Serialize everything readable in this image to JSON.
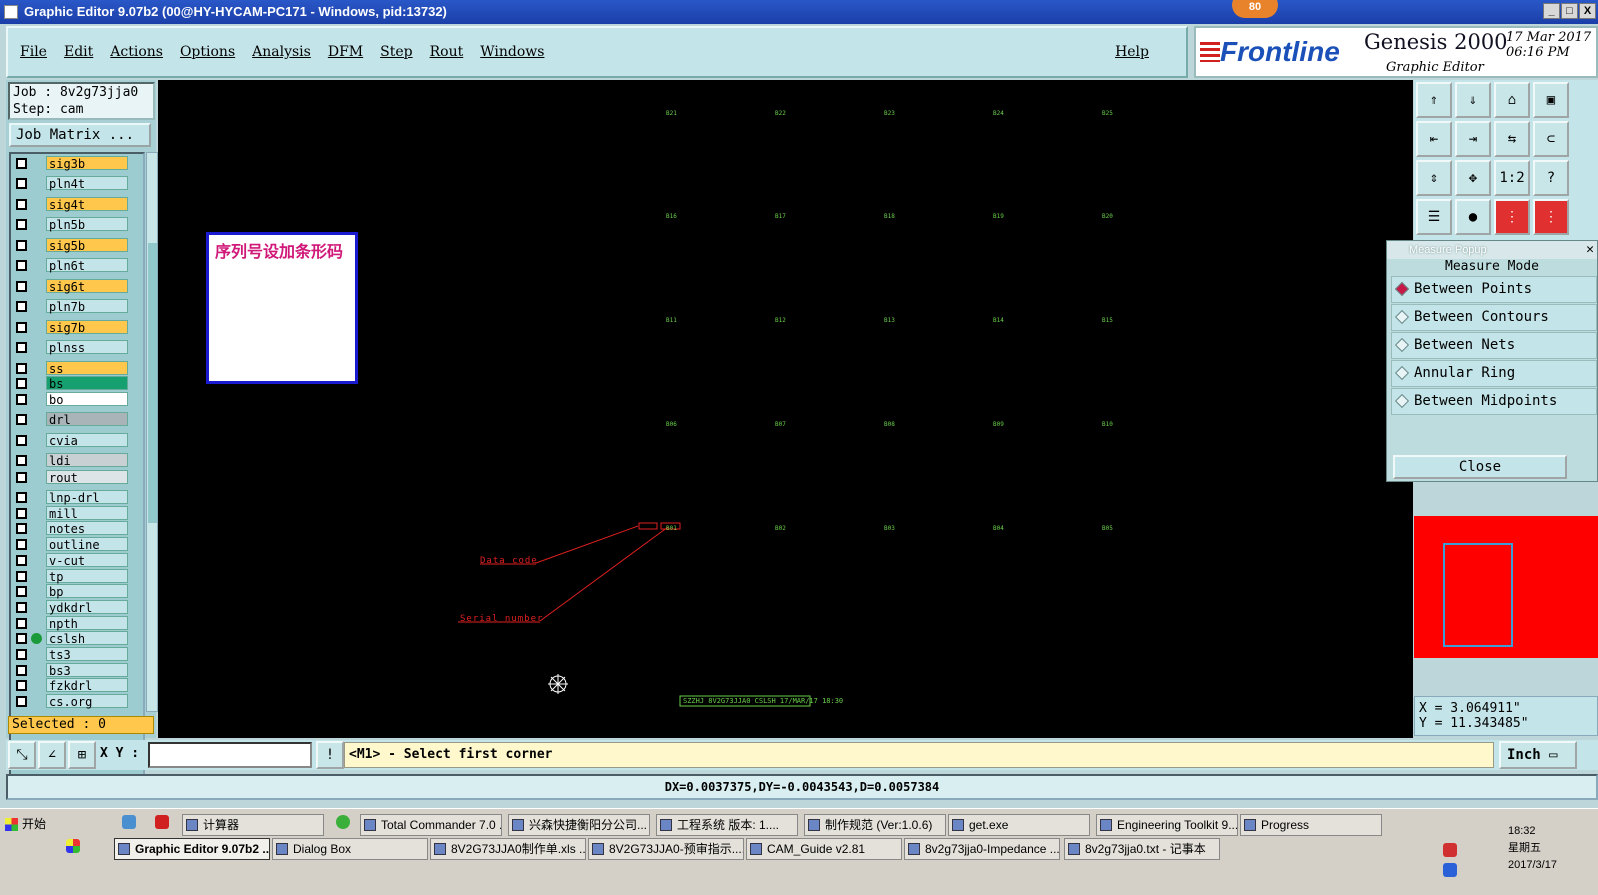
{
  "window": {
    "title": "Graphic Editor 9.07b2 (00@HY-HYCAM-PC171 - Windows, pid:13732)",
    "badge": "80",
    "controls": [
      "_",
      "□",
      "X"
    ]
  },
  "menu": {
    "items": [
      "File",
      "Edit",
      "Actions",
      "Options",
      "Analysis",
      "DFM",
      "Step",
      "Rout",
      "Windows"
    ],
    "help": "Help"
  },
  "brand": {
    "logo": "Frontline",
    "product": "Genesis 2000",
    "subtitle": "Graphic Editor",
    "date": "17 Mar 2017",
    "time": "06:16 PM"
  },
  "left": {
    "job": "Job : 8v2g73jja0",
    "step": "Step: cam",
    "job_matrix": "Job Matrix ...",
    "selected": "Selected : 0",
    "layers": [
      {
        "name": "sig3b",
        "color": "#ffc84c"
      },
      {
        "name": "pln4t",
        "color": "#c3e4e8"
      },
      {
        "name": "sig4t",
        "color": "#ffc84c"
      },
      {
        "name": "pln5b",
        "color": "#c3e4e8"
      },
      {
        "name": "sig5b",
        "color": "#ffc84c"
      },
      {
        "name": "pln6t",
        "color": "#c3e4e8"
      },
      {
        "name": "sig6t",
        "color": "#ffc84c"
      },
      {
        "name": "pln7b",
        "color": "#c3e4e8"
      },
      {
        "name": "sig7b",
        "color": "#ffc84c"
      },
      {
        "name": "plnss",
        "color": "#c3e4e8"
      },
      {
        "name": "ss",
        "color": "#ffc84c"
      },
      {
        "name": "bs",
        "color": "#16a070"
      },
      {
        "name": "bo",
        "color": "#ffffff"
      },
      {
        "name": "drl",
        "color": "#a8b4b8"
      },
      {
        "name": "cvia",
        "color": "#c3e4e8"
      },
      {
        "name": "ldi",
        "color": "#c8d0d4"
      },
      {
        "name": "rout",
        "color": "#dce4e8"
      },
      {
        "name": "lnp-drl",
        "color": "#c3e4e8"
      },
      {
        "name": "mill",
        "color": "#c3e4e8"
      },
      {
        "name": "notes",
        "color": "#c3e4e8"
      },
      {
        "name": "outline",
        "color": "#c3e4e8"
      },
      {
        "name": "v-cut",
        "color": "#c3e4e8"
      },
      {
        "name": "tp",
        "color": "#c3e4e8"
      },
      {
        "name": "bp",
        "color": "#c3e4e8"
      },
      {
        "name": "ydkdrl",
        "color": "#c3e4e8"
      },
      {
        "name": "npth",
        "color": "#c3e4e8"
      },
      {
        "name": "cslsh",
        "color": "#c3e4e8",
        "active": true
      },
      {
        "name": "ts3",
        "color": "#c3e4e8"
      },
      {
        "name": "bs3",
        "color": "#c3e4e8"
      },
      {
        "name": "fzkdrl",
        "color": "#c3e4e8"
      },
      {
        "name": "cs.org",
        "color": "#c3e4e8"
      }
    ]
  },
  "canvas": {
    "pads": [
      [
        "B21",
        "B22",
        "B23",
        "B24",
        "B25"
      ],
      [
        "B16",
        "B17",
        "B18",
        "B19",
        "B20"
      ],
      [
        "B11",
        "B12",
        "B13",
        "B14",
        "B15"
      ],
      [
        "B06",
        "B07",
        "B08",
        "B09",
        "B10"
      ],
      [
        "B01",
        "B02",
        "B03",
        "B04",
        "B05"
      ]
    ],
    "note": "序列号设加条形码",
    "label_data_code": "Data code",
    "label_serial": "Serial number",
    "bottom_text": "SZZHJ 8V2G73JJA0 CSLSH 17/MAR/17 18:30"
  },
  "right_icons": [
    "⇑",
    "⇓",
    "⌂",
    "▣",
    "⇤",
    "⇥",
    "⇆",
    "⊂",
    "⇕",
    "✥",
    "1:2",
    "?",
    "☰",
    "●",
    "⋮",
    "⋮"
  ],
  "measure": {
    "title": "Measure Popup",
    "mode_label": "Measure Mode",
    "options": [
      "Between Points",
      "Between Contours",
      "Between Nets",
      "Annular Ring",
      "Between Midpoints"
    ],
    "selected": 0,
    "close": "Close"
  },
  "coords": {
    "x": "X = 3.064911\"",
    "y": "Y = 11.343485\""
  },
  "bottom": {
    "xy_label": "X Y :",
    "excl": "!",
    "prompt": "<M1> - Select first corner",
    "unit": "Inch",
    "status": "DX=0.0037375,DY=-0.0043543,D=0.0057384"
  },
  "taskbar": {
    "start": "开始",
    "row1": [
      "计算器",
      "Total Commander 7.0 ...",
      "兴森快捷衡阳分公司...",
      "工程系统  版本: 1....",
      "制作规范 (Ver:1.0.6)",
      "get.exe",
      "Engineering Toolkit 9....",
      "Progress"
    ],
    "row2": [
      "Graphic Editor 9.07b2 ...",
      "Dialog Box",
      "8V2G73JJA0制作单.xls ...",
      "8V2G73JJA0-预审指示....",
      "CAM_Guide v2.81",
      "8v2g73jja0-Impedance ...",
      "8v2g73jja0.txt - 记事本"
    ],
    "clock_time": "18:32",
    "clock_day": "星期五",
    "clock_date": "2017/3/17"
  }
}
